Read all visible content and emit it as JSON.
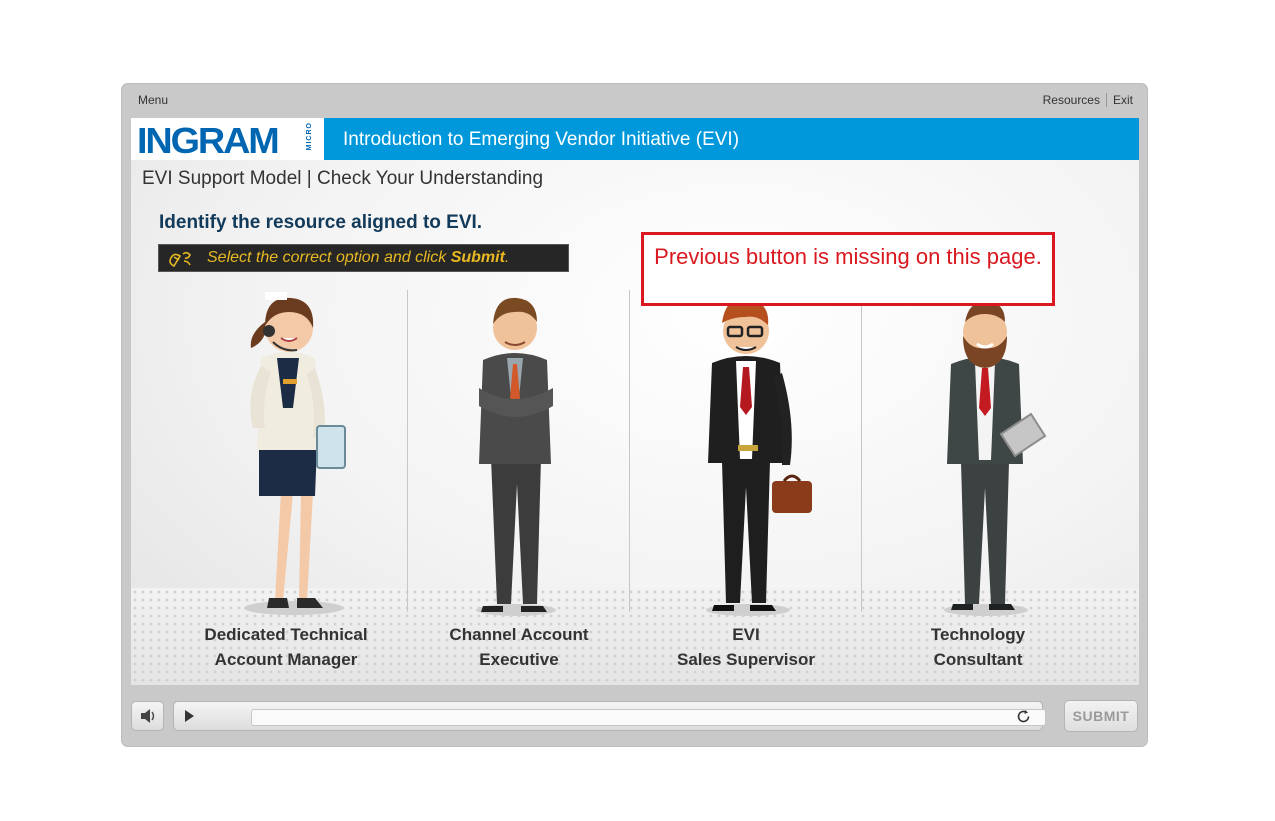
{
  "topbar": {
    "menu": "Menu",
    "resources": "Resources",
    "exit": "Exit"
  },
  "header": {
    "logo_text": "INGRAM",
    "logo_micro": "MICRO",
    "course_title": "Introduction to Emerging Vendor Initiative (EVI)"
  },
  "slide": {
    "title": "EVI Support Model | Check Your Understanding",
    "question": "Identify the resource aligned to EVI.",
    "instruction_prefix": "Select the correct option and click ",
    "instruction_action": "Submit",
    "instruction_suffix": ".",
    "options": [
      {
        "line1": "Dedicated Technical",
        "line2": "Account Manager"
      },
      {
        "line1": "Channel Account",
        "line2": "Executive"
      },
      {
        "line1": "EVI",
        "line2": "Sales Supervisor"
      },
      {
        "line1": "Technology",
        "line2": "Consultant"
      }
    ]
  },
  "callout": {
    "text": "Previous button is missing on this page."
  },
  "controls": {
    "submit_label": "SUBMIT"
  },
  "icons": [
    "volume-icon",
    "play-icon",
    "replay-icon",
    "mouse-click-icon"
  ],
  "colors": {
    "accent": "#0098da",
    "brand": "#0066b2",
    "callout": "#d9181f",
    "instruction": "#e8b923"
  }
}
